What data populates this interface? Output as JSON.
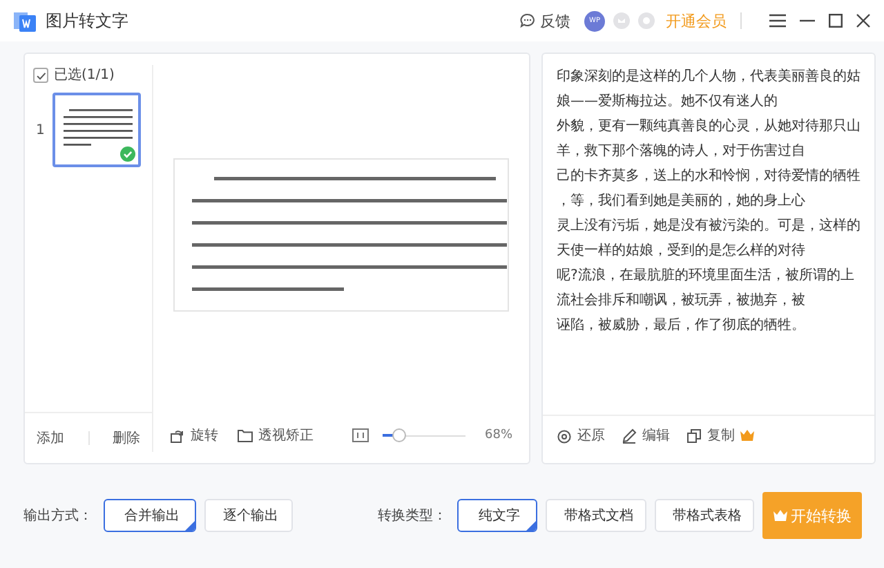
{
  "window": {
    "title": "图片转文字"
  },
  "header": {
    "feedback": "反馈",
    "avatar": "WP",
    "vip": "开通会员"
  },
  "thumbnails": {
    "select_all": {
      "label": "已选(1/1)",
      "checked": true
    },
    "items": [
      {
        "index": "1",
        "selected": true,
        "checked": true
      }
    ],
    "actions": [
      "添加",
      "删除"
    ]
  },
  "preview": {
    "tools": [
      "旋转",
      "透视矫正"
    ],
    "zoom": {
      "level": 0.2,
      "reading": "68%"
    }
  },
  "result": {
    "lines": [
      "印象深刻的是这样的几个人物，代表美丽善良的姑",
      "娘——爱斯梅拉达。她不仅有迷人的",
      "外貌，更有一颗纯真善良的心灵，从她对待那只山",
      "羊，救下那个落魄的诗人，对于伤害过自",
      "己的卡齐莫多，送上的水和怜悯，对待爱情的牺牲",
      "，等，我们看到她是美丽的，她的身上心",
      "灵上没有污垢，她是没有被污染的。可是，这样的",
      "天使一样的姑娘，受到的是怎么样的对待",
      "呢?流浪，在最肮脏的环境里面生活，被所谓的上",
      "流社会排斥和嘲讽，被玩弄，被抛弃，被",
      "诬陷，被威胁，最后，作了彻底的牺牲。"
    ],
    "actions": [
      "还原",
      "编辑",
      "复制"
    ]
  },
  "options": {
    "output_mode": {
      "label": "输出方式：",
      "choices": [
        {
          "label": "合并输出",
          "selected": true
        },
        {
          "label": "逐个输出",
          "selected": false
        }
      ]
    },
    "convert_type": {
      "label": "转换类型：",
      "choices": [
        {
          "label": "纯文字",
          "selected": true
        },
        {
          "label": "带格式文档",
          "selected": false
        },
        {
          "label": "带格式表格",
          "selected": false
        }
      ]
    }
  },
  "start_button": "开始转换"
}
